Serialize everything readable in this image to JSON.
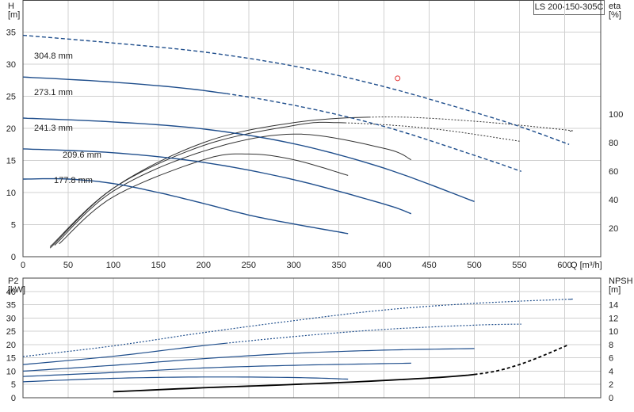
{
  "model_label": "LS 200-150-305C",
  "colors": {
    "impeller": "#1f4e8c",
    "efficiency": "#333333",
    "npsh": "#000000",
    "duty_point": "#e03030",
    "grid": "#d0d0d0"
  },
  "chart_data": [
    {
      "type": "line",
      "title": "",
      "left_axis": {
        "label": "H",
        "unit": "[m]",
        "ylim": [
          0,
          40
        ],
        "ticks": [
          0,
          5,
          10,
          15,
          20,
          25,
          30,
          35
        ]
      },
      "right_axis": {
        "label": "eta",
        "unit": "[%]",
        "ylim": [
          0,
          180
        ],
        "ticks": [
          20,
          40,
          60,
          80,
          100
        ]
      },
      "x_axis": {
        "label": "Q [m³/h]",
        "xlim": [
          0,
          640
        ],
        "ticks": [
          0,
          50,
          100,
          150,
          200,
          250,
          300,
          350,
          400,
          450,
          500,
          550,
          600
        ]
      },
      "grid": true,
      "head_curves": [
        {
          "name": "304.8 mm",
          "x": [
            0,
            100,
            200,
            300,
            400,
            500,
            550,
            605
          ],
          "y": [
            34.5,
            33.3,
            31.9,
            29.7,
            26.5,
            22.5,
            20.3,
            17.5
          ],
          "solid_until": 0
        },
        {
          "name": "273.1 mm",
          "x": [
            0,
            100,
            200,
            300,
            400,
            500,
            552
          ],
          "y": [
            28.0,
            27.2,
            25.9,
            23.6,
            20.3,
            15.8,
            13.3
          ],
          "solid_until": 230
        },
        {
          "name": "241.3 mm",
          "x": [
            0,
            100,
            200,
            300,
            400,
            500
          ],
          "y": [
            21.6,
            21.0,
            19.9,
            17.6,
            13.8,
            8.6
          ],
          "solid_until": 500
        },
        {
          "name": "209.6 mm",
          "x": [
            0,
            100,
            200,
            300,
            400,
            430
          ],
          "y": [
            16.8,
            16.2,
            14.7,
            12.0,
            8.2,
            6.7
          ],
          "solid_until": 430
        },
        {
          "name": "177.8 mm",
          "x": [
            0,
            50,
            100,
            150,
            200,
            250,
            300,
            360
          ],
          "y": [
            12.1,
            12.1,
            11.4,
            10.0,
            8.3,
            6.5,
            5.1,
            3.6
          ],
          "solid_until": 360
        }
      ],
      "efficiency_curves": [
        {
          "x": [
            30,
            100,
            200,
            300,
            400,
            500,
            600,
            605
          ],
          "y": [
            6,
            48,
            80,
            94,
            98,
            95,
            89,
            88
          ],
          "solid_until": 390
        },
        {
          "x": [
            30,
            100,
            200,
            300,
            350,
            450,
            550
          ],
          "y": [
            7,
            48,
            78,
            92,
            94,
            90,
            81
          ],
          "solid_until": 360
        },
        {
          "x": [
            35,
            100,
            200,
            300,
            400,
            430
          ],
          "y": [
            8,
            46,
            74,
            86,
            76,
            68
          ],
          "solid_until": 430
        },
        {
          "x": [
            40,
            100,
            200,
            250,
            300,
            360
          ],
          "y": [
            9,
            42,
            68,
            72,
            68,
            57
          ],
          "solid_until": 360
        }
      ],
      "duty_point": {
        "x": 415,
        "y": 27.8
      }
    },
    {
      "type": "line",
      "title": "",
      "left_axis": {
        "label": "P2",
        "unit": "[kW]",
        "ylim": [
          0,
          45
        ],
        "ticks": [
          0,
          5,
          10,
          15,
          20,
          25,
          30,
          35,
          40
        ]
      },
      "right_axis": {
        "label": "NPSH",
        "unit": "[m]",
        "ylim": [
          0,
          18
        ],
        "ticks": [
          0,
          2,
          4,
          6,
          8,
          10,
          12,
          14
        ]
      },
      "x_axis": {
        "xlim": [
          0,
          640
        ]
      },
      "grid": true,
      "power_curves": [
        {
          "x": [
            0,
            100,
            200,
            300,
            400,
            500,
            600,
            605
          ],
          "y": [
            15.5,
            19.5,
            24.5,
            29,
            33,
            35.5,
            37,
            37
          ],
          "solid_until": 0
        },
        {
          "x": [
            0,
            100,
            200,
            300,
            400,
            500,
            552
          ],
          "y": [
            12.5,
            15.6,
            19.6,
            23,
            25.7,
            27.3,
            27.7
          ],
          "solid_until": 230
        },
        {
          "x": [
            0,
            100,
            200,
            300,
            400,
            500
          ],
          "y": [
            10,
            12.2,
            14.7,
            16.7,
            17.9,
            18.5
          ],
          "solid_until": 500
        },
        {
          "x": [
            0,
            100,
            200,
            300,
            430
          ],
          "y": [
            8,
            9.5,
            11.2,
            12.2,
            13
          ],
          "solid_until": 430
        },
        {
          "x": [
            0,
            100,
            200,
            300,
            360
          ],
          "y": [
            6,
            7.3,
            7.8,
            7.6,
            7
          ],
          "solid_until": 360
        }
      ],
      "npsh_curve": {
        "x": [
          100,
          200,
          300,
          400,
          500,
          550,
          605
        ],
        "y": [
          0.9,
          1.5,
          2.0,
          2.6,
          3.5,
          5.0,
          8.0
        ],
        "solid_until": 500
      }
    }
  ]
}
